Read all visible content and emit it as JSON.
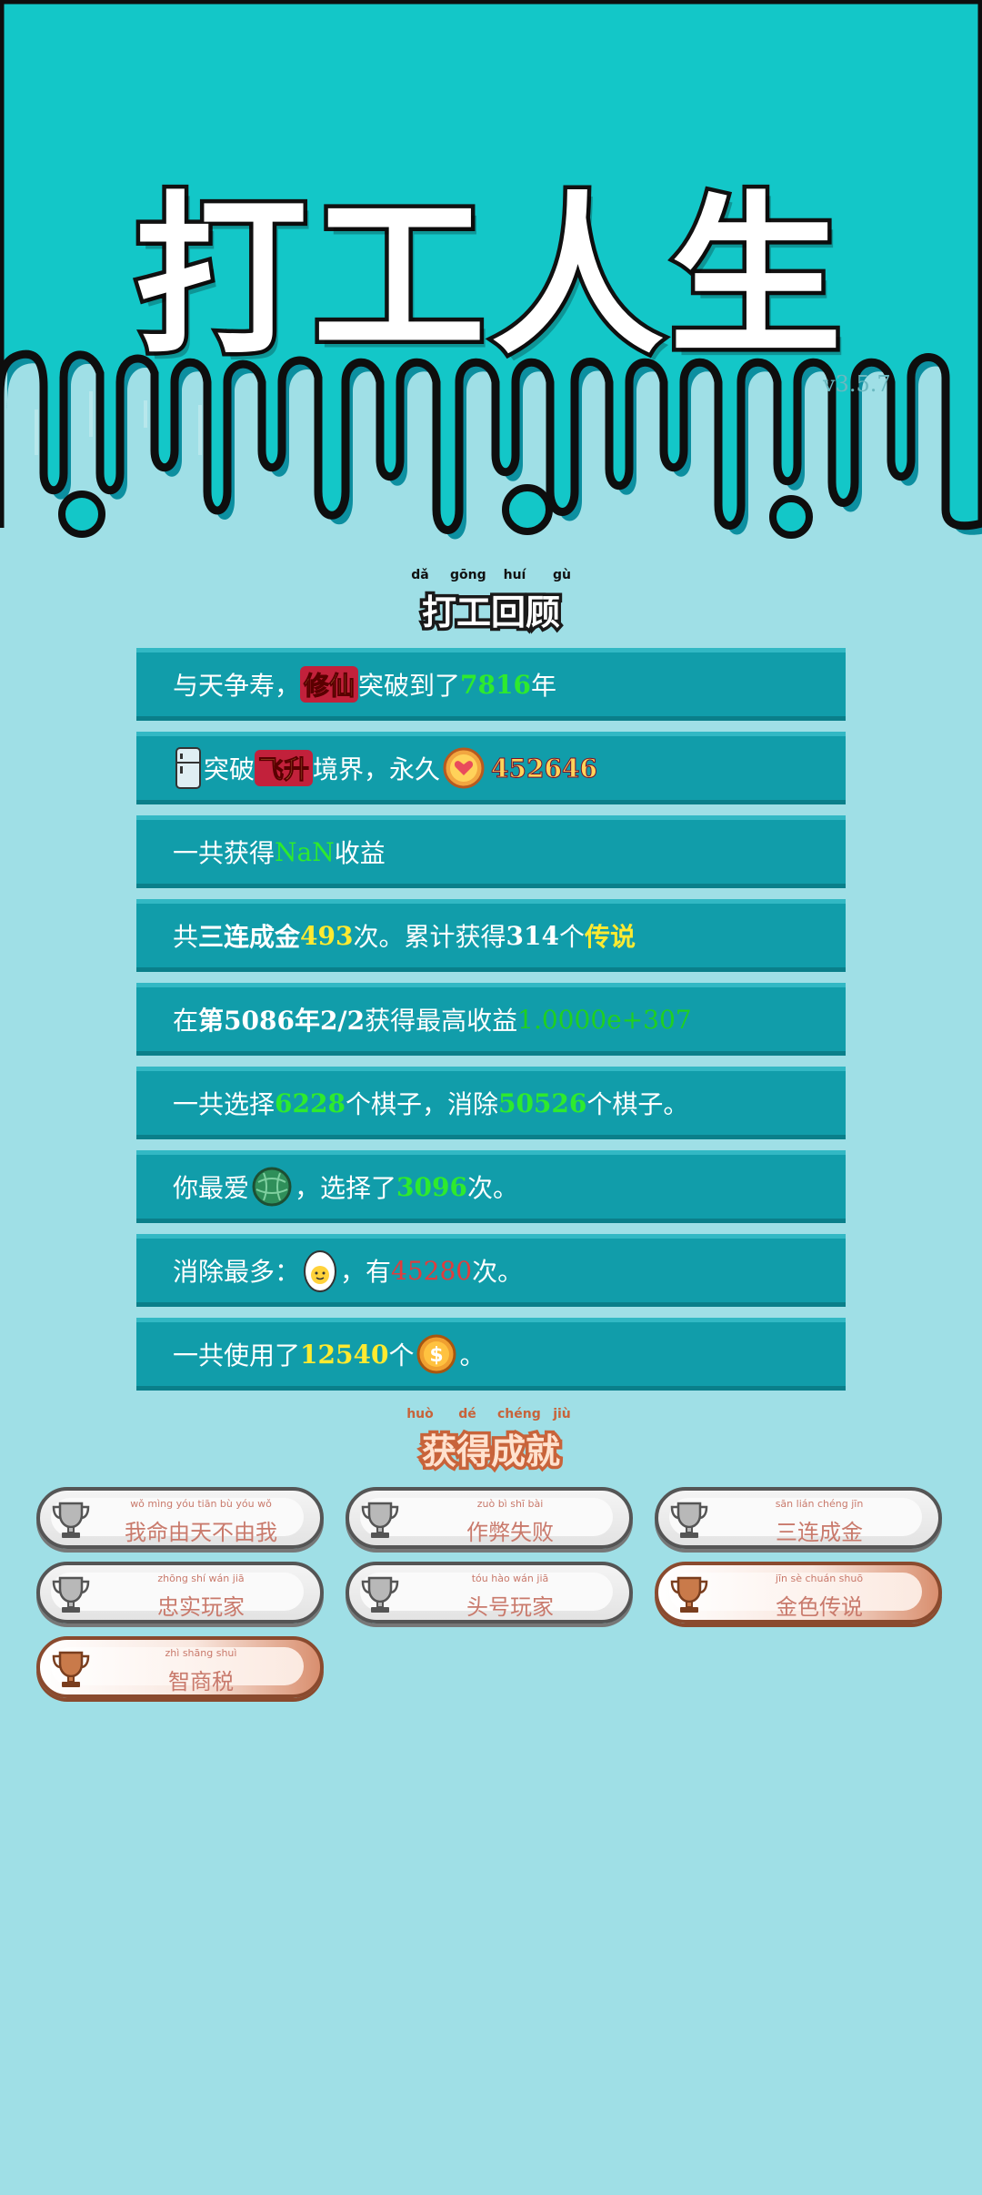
{
  "app": {
    "title": "打工人生",
    "version": "v3.5.7"
  },
  "review": {
    "title": "打工回顾",
    "title_pinyin": [
      "dǎ",
      "gōng",
      "huí",
      "gù"
    ],
    "lines": [
      {
        "a": "与天争寿，",
        "b": "修仙",
        "c": "突破到了",
        "d": "7816",
        "e": "年"
      },
      {
        "a": "突破",
        "b": "飞升",
        "c": "境界，永久",
        "d": "452646"
      },
      {
        "a": "一共获得",
        "b": "NaN",
        "c": "收益"
      },
      {
        "a": "共",
        "b": "三连成金",
        "c": "493",
        "d": "次。累计获得",
        "e": "314",
        "f": "个",
        "g": "传说"
      },
      {
        "a": "在 ",
        "b": "第5086年2/2",
        "c": " 获得最高收益",
        "d": "1.0000e+307"
      },
      {
        "a": "一共选择",
        "b": "6228",
        "c": "个棋子，消除",
        "d": "50526",
        "e": "个棋子。"
      },
      {
        "a": "你最爱",
        "b": "，选择了",
        "c": "3096",
        "d": "次。"
      },
      {
        "a": "消除最多：",
        "b": "，有",
        "c": "45280",
        "d": "次。"
      },
      {
        "a": "一共使用了",
        "b": "12540",
        "c": "个",
        "d": "。"
      }
    ]
  },
  "achievements": {
    "title": "获得成就",
    "title_pinyin": [
      "huò",
      "dé",
      "chéng",
      "jiù"
    ],
    "items": [
      {
        "label": "我命由天不由我",
        "pinyin": "wǒ mìng yóu tiān bù yóu wǒ",
        "tier": "silver"
      },
      {
        "label": "作弊失败",
        "pinyin": "zuò bì shī bài",
        "tier": "silver"
      },
      {
        "label": "三连成金",
        "pinyin": "sān lián chéng jīn",
        "tier": "silver"
      },
      {
        "label": "忠实玩家",
        "pinyin": "zhōng shí wán jiā",
        "tier": "silver"
      },
      {
        "label": "头号玩家",
        "pinyin": "tóu hào wán jiā",
        "tier": "silver"
      },
      {
        "label": "金色传说",
        "pinyin": "jīn sè chuán shuō",
        "tier": "bronze"
      },
      {
        "label": "智商税",
        "pinyin": "zhì shāng shuì",
        "tier": "bronze"
      }
    ]
  },
  "colors": {
    "teal_top": "#13c7c8",
    "teal_bottom": "#9fdfe6",
    "card": "#119daa",
    "highlight_green": "#2eea2e",
    "highlight_yellow": "#ffea30"
  },
  "icons": [
    "fridge-icon",
    "heart-coin-icon",
    "watermelon-icon",
    "egg-icon",
    "coin-icon",
    "trophy-icon"
  ]
}
